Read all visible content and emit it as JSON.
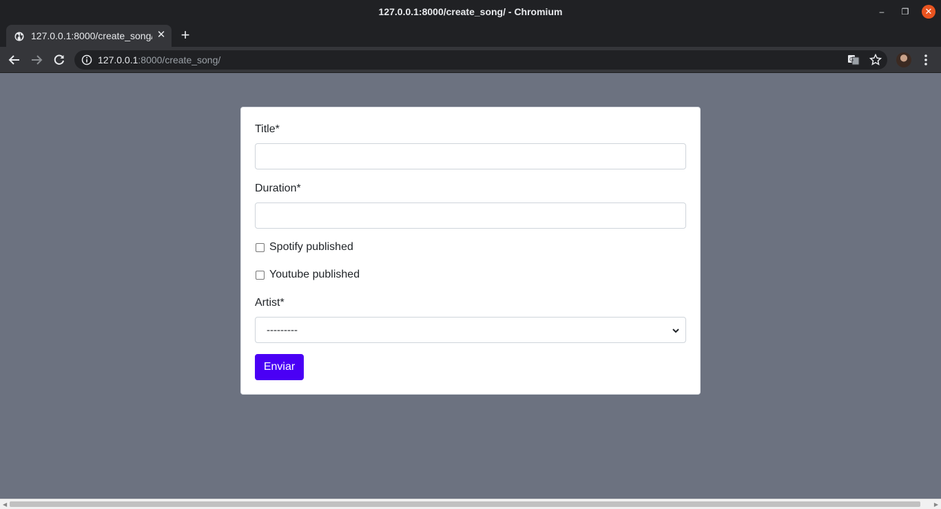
{
  "window": {
    "title": "127.0.0.1:8000/create_song/ - Chromium",
    "minimize_glyph": "–",
    "maximize_glyph": "❐",
    "close_glyph": "✕"
  },
  "tab": {
    "label": "127.0.0.1:8000/create_song/",
    "favicon": "globe-icon",
    "close_glyph": "✕",
    "new_tab_glyph": "+"
  },
  "toolbar": {
    "back_icon": "back-arrow-icon",
    "forward_icon": "forward-arrow-icon",
    "reload_icon": "reload-icon",
    "url_host": "127.0.0.1",
    "url_rest": ":8000/create_song/",
    "translate_icon": "translate-icon",
    "bookmark_icon": "star-icon",
    "menu_icon": "kebab-menu-icon"
  },
  "form": {
    "title_label": "Title*",
    "title_value": "",
    "duration_label": "Duration*",
    "duration_value": "",
    "spotify_label": "Spotify published",
    "spotify_checked": false,
    "youtube_label": "Youtube published",
    "youtube_checked": false,
    "artist_label": "Artist*",
    "artist_selected": "---------",
    "submit_label": "Enviar"
  },
  "colors": {
    "page_background": "#6c7280",
    "submit_button": "#4a00f5",
    "close_button": "#e95420"
  }
}
